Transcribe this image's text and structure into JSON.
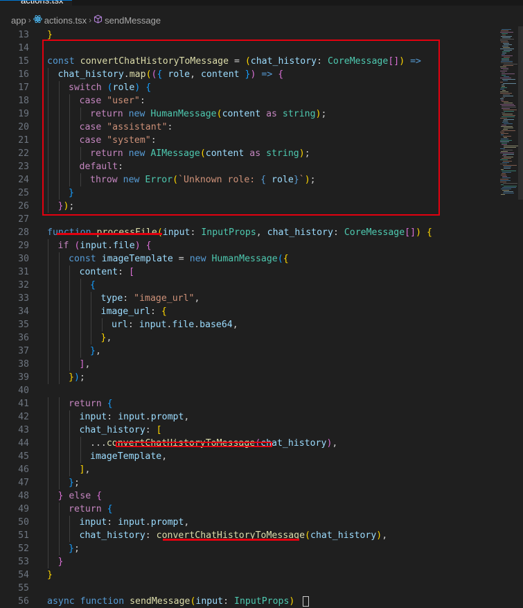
{
  "tab": {
    "label": "actions.tsx"
  },
  "breadcrumb": {
    "items": [
      "app",
      "actions.tsx",
      "sendMessage"
    ]
  },
  "editor": {
    "lines": [
      {
        "n": "13",
        "indent": 0,
        "tokens": [
          [
            "b1",
            "}"
          ]
        ]
      },
      {
        "n": "14",
        "indent": 0,
        "tokens": []
      },
      {
        "n": "15",
        "indent": 0,
        "tokens": [
          [
            "kw",
            "const "
          ],
          [
            "fn",
            "convertChatHistoryToMessage"
          ],
          [
            "txt",
            " = "
          ],
          [
            "b1",
            "("
          ],
          [
            "var",
            "chat_history"
          ],
          [
            "txt",
            ": "
          ],
          [
            "cls",
            "CoreMessage"
          ],
          [
            "b2",
            "[]"
          ],
          [
            "b1",
            ")"
          ],
          [
            "kw",
            " =>"
          ]
        ]
      },
      {
        "n": "16",
        "indent": 1,
        "tokens": [
          [
            "var",
            "chat_history"
          ],
          [
            "txt",
            "."
          ],
          [
            "fn",
            "map"
          ],
          [
            "b1",
            "("
          ],
          [
            "b2",
            "("
          ],
          [
            "b3",
            "{ "
          ],
          [
            "var",
            "role"
          ],
          [
            "txt",
            ", "
          ],
          [
            "var",
            "content"
          ],
          [
            "b3",
            " }"
          ],
          [
            "b2",
            ")"
          ],
          [
            "kw",
            " =>"
          ],
          [
            "b2",
            " {"
          ]
        ]
      },
      {
        "n": "17",
        "indent": 2,
        "tokens": [
          [
            "ctl",
            "switch"
          ],
          [
            "txt",
            " "
          ],
          [
            "b3",
            "("
          ],
          [
            "var",
            "role"
          ],
          [
            "b3",
            ")"
          ],
          [
            "b3",
            " {"
          ]
        ]
      },
      {
        "n": "18",
        "indent": 3,
        "tokens": [
          [
            "ctl",
            "case "
          ],
          [
            "str",
            "\"user\""
          ],
          [
            "txt",
            ":"
          ]
        ]
      },
      {
        "n": "19",
        "indent": 4,
        "tokens": [
          [
            "ctl",
            "return "
          ],
          [
            "kw",
            "new "
          ],
          [
            "cls",
            "HumanMessage"
          ],
          [
            "b1",
            "("
          ],
          [
            "var",
            "content"
          ],
          [
            "ctl",
            " as "
          ],
          [
            "cls",
            "string"
          ],
          [
            "b1",
            ")"
          ],
          [
            "txt",
            ";"
          ]
        ]
      },
      {
        "n": "20",
        "indent": 3,
        "tokens": [
          [
            "ctl",
            "case "
          ],
          [
            "str",
            "\"assistant\""
          ],
          [
            "txt",
            ":"
          ]
        ]
      },
      {
        "n": "21",
        "indent": 3,
        "tokens": [
          [
            "ctl",
            "case "
          ],
          [
            "str",
            "\"system\""
          ],
          [
            "txt",
            ":"
          ]
        ]
      },
      {
        "n": "22",
        "indent": 4,
        "tokens": [
          [
            "ctl",
            "return "
          ],
          [
            "kw",
            "new "
          ],
          [
            "cls",
            "AIMessage"
          ],
          [
            "b1",
            "("
          ],
          [
            "var",
            "content"
          ],
          [
            "ctl",
            " as "
          ],
          [
            "cls",
            "string"
          ],
          [
            "b1",
            ")"
          ],
          [
            "txt",
            ";"
          ]
        ]
      },
      {
        "n": "23",
        "indent": 3,
        "tokens": [
          [
            "ctl",
            "default"
          ],
          [
            "txt",
            ":"
          ]
        ]
      },
      {
        "n": "24",
        "indent": 4,
        "tokens": [
          [
            "ctl",
            "throw "
          ],
          [
            "kw",
            "new "
          ],
          [
            "cls",
            "Error"
          ],
          [
            "b1",
            "("
          ],
          [
            "str",
            "`Unknown role: "
          ],
          [
            "kw",
            "{ "
          ],
          [
            "var",
            "role"
          ],
          [
            "kw",
            "}"
          ],
          [
            "str",
            "`"
          ],
          [
            "b1",
            ")"
          ],
          [
            "txt",
            ";"
          ]
        ]
      },
      {
        "n": "25",
        "indent": 2,
        "tokens": [
          [
            "b3",
            "}"
          ]
        ]
      },
      {
        "n": "26",
        "indent": 1,
        "tokens": [
          [
            "b2",
            "}"
          ],
          [
            "b1",
            ")"
          ],
          [
            "txt",
            ";"
          ]
        ]
      },
      {
        "n": "27",
        "indent": 0,
        "tokens": []
      },
      {
        "n": "28",
        "indent": 0,
        "tokens": [
          [
            "kw",
            "function "
          ],
          [
            "fn",
            "processFile"
          ],
          [
            "b1",
            "("
          ],
          [
            "var",
            "input"
          ],
          [
            "txt",
            ": "
          ],
          [
            "cls",
            "InputProps"
          ],
          [
            "txt",
            ", "
          ],
          [
            "var",
            "chat_history"
          ],
          [
            "txt",
            ": "
          ],
          [
            "cls",
            "CoreMessage"
          ],
          [
            "b2",
            "[]"
          ],
          [
            "b1",
            ")"
          ],
          [
            "b1",
            " {"
          ]
        ]
      },
      {
        "n": "29",
        "indent": 1,
        "tokens": [
          [
            "ctl",
            "if "
          ],
          [
            "b2",
            "("
          ],
          [
            "var",
            "input"
          ],
          [
            "txt",
            "."
          ],
          [
            "var",
            "file"
          ],
          [
            "b2",
            ")"
          ],
          [
            "b2",
            " {"
          ]
        ]
      },
      {
        "n": "30",
        "indent": 2,
        "tokens": [
          [
            "kw",
            "const "
          ],
          [
            "var",
            "imageTemplate"
          ],
          [
            "txt",
            " = "
          ],
          [
            "kw",
            "new "
          ],
          [
            "cls",
            "HumanMessage"
          ],
          [
            "b3",
            "("
          ],
          [
            "b1",
            "{"
          ]
        ]
      },
      {
        "n": "31",
        "indent": 3,
        "tokens": [
          [
            "var",
            "content"
          ],
          [
            "txt",
            ": "
          ],
          [
            "b2",
            "["
          ]
        ]
      },
      {
        "n": "32",
        "indent": 4,
        "tokens": [
          [
            "b3",
            "{"
          ]
        ]
      },
      {
        "n": "33",
        "indent": 5,
        "tokens": [
          [
            "var",
            "type"
          ],
          [
            "txt",
            ": "
          ],
          [
            "str",
            "\"image_url\""
          ],
          [
            "txt",
            ","
          ]
        ]
      },
      {
        "n": "34",
        "indent": 5,
        "tokens": [
          [
            "var",
            "image_url"
          ],
          [
            "txt",
            ": "
          ],
          [
            "b1",
            "{"
          ]
        ]
      },
      {
        "n": "35",
        "indent": 6,
        "tokens": [
          [
            "var",
            "url"
          ],
          [
            "txt",
            ": "
          ],
          [
            "var",
            "input"
          ],
          [
            "txt",
            "."
          ],
          [
            "var",
            "file"
          ],
          [
            "txt",
            "."
          ],
          [
            "var",
            "base64"
          ],
          [
            "txt",
            ","
          ]
        ]
      },
      {
        "n": "36",
        "indent": 5,
        "tokens": [
          [
            "b1",
            "}"
          ],
          [
            "txt",
            ","
          ]
        ]
      },
      {
        "n": "37",
        "indent": 4,
        "tokens": [
          [
            "b3",
            "}"
          ],
          [
            "txt",
            ","
          ]
        ]
      },
      {
        "n": "38",
        "indent": 3,
        "tokens": [
          [
            "b2",
            "]"
          ],
          [
            "txt",
            ","
          ]
        ]
      },
      {
        "n": "39",
        "indent": 2,
        "tokens": [
          [
            "b1",
            "}"
          ],
          [
            "b3",
            ")"
          ],
          [
            "txt",
            ";"
          ]
        ]
      },
      {
        "n": "40",
        "indent": 0,
        "tokens": []
      },
      {
        "n": "41",
        "indent": 2,
        "tokens": [
          [
            "ctl",
            "return "
          ],
          [
            "b3",
            "{"
          ]
        ]
      },
      {
        "n": "42",
        "indent": 3,
        "tokens": [
          [
            "var",
            "input"
          ],
          [
            "txt",
            ": "
          ],
          [
            "var",
            "input"
          ],
          [
            "txt",
            "."
          ],
          [
            "var",
            "prompt"
          ],
          [
            "txt",
            ","
          ]
        ]
      },
      {
        "n": "43",
        "indent": 3,
        "tokens": [
          [
            "var",
            "chat_history"
          ],
          [
            "txt",
            ": "
          ],
          [
            "b1",
            "["
          ]
        ]
      },
      {
        "n": "44",
        "indent": 4,
        "tokens": [
          [
            "txt",
            "..."
          ],
          [
            "fn",
            "convertChatHistoryToMessage"
          ],
          [
            "b2",
            "("
          ],
          [
            "var",
            "chat_history"
          ],
          [
            "b2",
            ")"
          ],
          [
            "txt",
            ","
          ]
        ]
      },
      {
        "n": "45",
        "indent": 4,
        "tokens": [
          [
            "var",
            "imageTemplate"
          ],
          [
            "txt",
            ","
          ]
        ]
      },
      {
        "n": "46",
        "indent": 3,
        "tokens": [
          [
            "b1",
            "]"
          ],
          [
            "txt",
            ","
          ]
        ]
      },
      {
        "n": "47",
        "indent": 2,
        "tokens": [
          [
            "b3",
            "}"
          ],
          [
            "txt",
            ";"
          ]
        ]
      },
      {
        "n": "48",
        "indent": 1,
        "tokens": [
          [
            "b2",
            "}"
          ],
          [
            "ctl",
            " else "
          ],
          [
            "b2",
            "{"
          ]
        ]
      },
      {
        "n": "49",
        "indent": 2,
        "tokens": [
          [
            "ctl",
            "return "
          ],
          [
            "b3",
            "{"
          ]
        ]
      },
      {
        "n": "50",
        "indent": 3,
        "tokens": [
          [
            "var",
            "input"
          ],
          [
            "txt",
            ": "
          ],
          [
            "var",
            "input"
          ],
          [
            "txt",
            "."
          ],
          [
            "var",
            "prompt"
          ],
          [
            "txt",
            ","
          ]
        ]
      },
      {
        "n": "51",
        "indent": 3,
        "tokens": [
          [
            "var",
            "chat_history"
          ],
          [
            "txt",
            ": "
          ],
          [
            "fn",
            "convertChatHistoryToMessage"
          ],
          [
            "b1",
            "("
          ],
          [
            "var",
            "chat_history"
          ],
          [
            "b1",
            ")"
          ],
          [
            "txt",
            ","
          ]
        ]
      },
      {
        "n": "52",
        "indent": 2,
        "tokens": [
          [
            "b3",
            "}"
          ],
          [
            "txt",
            ";"
          ]
        ]
      },
      {
        "n": "53",
        "indent": 1,
        "tokens": [
          [
            "b2",
            "}"
          ]
        ]
      },
      {
        "n": "54",
        "indent": 0,
        "tokens": [
          [
            "b1",
            "}"
          ]
        ]
      },
      {
        "n": "55",
        "indent": 0,
        "tokens": []
      },
      {
        "n": "56",
        "indent": 0,
        "tokens": [
          [
            "kw",
            "async "
          ],
          [
            "kw",
            "function "
          ],
          [
            "fn",
            "sendMessage"
          ],
          [
            "b1",
            "("
          ],
          [
            "var",
            "input"
          ],
          [
            "txt",
            ": "
          ],
          [
            "cls",
            "InputProps"
          ],
          [
            "b1",
            ")"
          ],
          [
            "txt",
            " "
          ]
        ]
      }
    ]
  },
  "colors": {
    "highlight": "#e3000f",
    "editor_bg": "#1f1f1f",
    "accent": "#0078d4"
  },
  "icons": {
    "file": "react-tsx-icon",
    "symbol": "method-cube-icon",
    "separator": "chevron-right-icon"
  }
}
